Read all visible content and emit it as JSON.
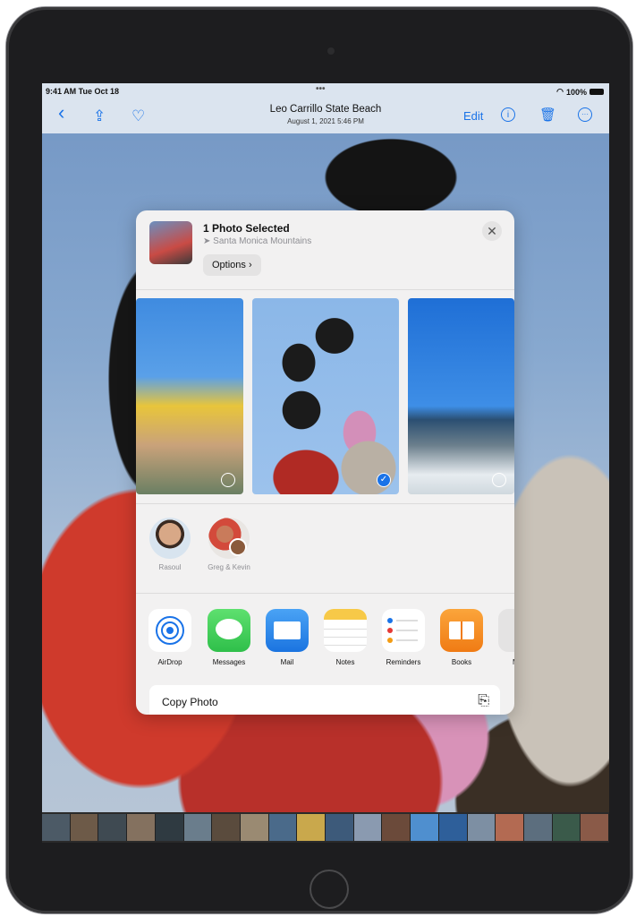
{
  "status": {
    "time": "9:41 AM  Tue Oct 18",
    "dots": "•••",
    "battery": "100%"
  },
  "nav": {
    "back_icon": "‹",
    "share_icon": "⇪",
    "favorite_icon": "♡",
    "title": "Leo Carrillo State Beach",
    "subtitle": "August 1, 2021  5:46 PM",
    "edit_label": "Edit",
    "info_icon": "i",
    "trash_icon": "🗑",
    "more_icon": "···"
  },
  "share_sheet": {
    "title": "1 Photo Selected",
    "location": "Santa Monica Mountains",
    "location_icon": "➤",
    "options_label": "Options ›",
    "close_icon": "✕",
    "check_icon": "✓",
    "people": [
      {
        "name": "Rasoul"
      },
      {
        "name": "Greg & Kevin"
      }
    ],
    "apps": [
      {
        "label": "AirDrop"
      },
      {
        "label": "Messages"
      },
      {
        "label": "Mail"
      },
      {
        "label": "Notes"
      },
      {
        "label": "Reminders"
      },
      {
        "label": "Books"
      },
      {
        "label": "M"
      }
    ],
    "copy_label": "Copy Photo",
    "copy_icon": "⎘"
  },
  "colors": {
    "accent": "#1a73e8",
    "sheet_bg": "#f2f1f1"
  }
}
